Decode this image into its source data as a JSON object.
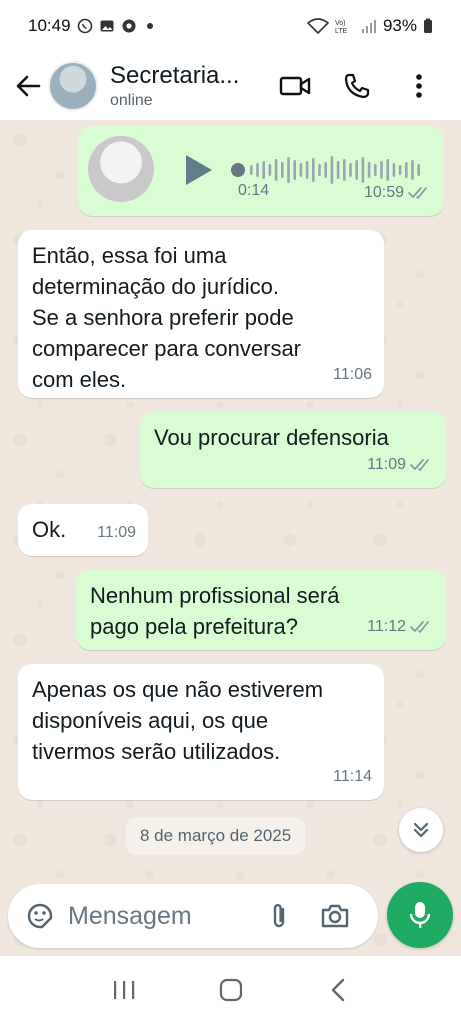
{
  "status_bar": {
    "time": "10:49",
    "battery": "93%"
  },
  "header": {
    "contact_name": "Secretaria...",
    "contact_status": "online"
  },
  "messages": [
    {
      "type": "voice",
      "direction": "out",
      "duration": "0:14",
      "time": "10:59",
      "read": true
    },
    {
      "type": "text",
      "direction": "in",
      "lines": [
        "Então, essa foi uma",
        "determinação do jurídico.",
        "Se a senhora preferir pode",
        "comparecer para conversar",
        "com eles."
      ],
      "time": "11:06"
    },
    {
      "type": "text",
      "direction": "out",
      "text": "Vou procurar defensoria",
      "time": "11:09",
      "read": true
    },
    {
      "type": "text",
      "direction": "in",
      "text": "Ok.",
      "time": "11:09"
    },
    {
      "type": "text",
      "direction": "out",
      "lines": [
        "Nenhum profissional será",
        "pago pela prefeitura?"
      ],
      "time": "11:12",
      "read": true
    },
    {
      "type": "text",
      "direction": "in",
      "lines": [
        "Apenas os que não estiverem",
        "disponíveis aqui, os que",
        "tivermos serão utilizados."
      ],
      "time": "11:14"
    }
  ],
  "date_chip": "8 de março de 2025",
  "input": {
    "placeholder": "Mensagem"
  },
  "colors": {
    "outgoing_bubble": "#d9fdd3",
    "incoming_bubble": "#ffffff",
    "chat_background": "#efe7dd",
    "accent": "#1daa61",
    "read_ticks": "#53bdeb"
  }
}
